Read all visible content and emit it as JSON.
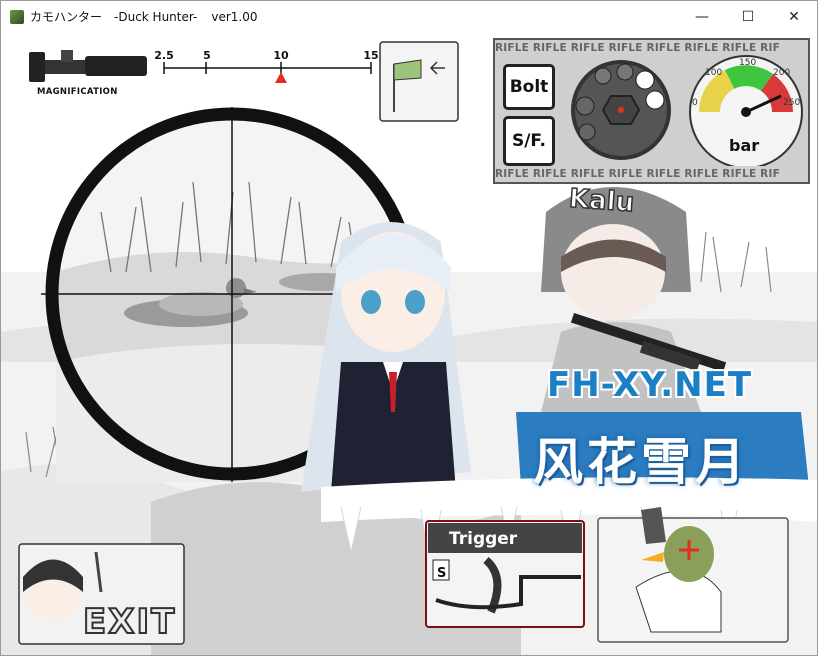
{
  "window": {
    "title_parts": [
      "カモハンター",
      "-Duck Hunter-",
      "ver1.00"
    ],
    "controls": {
      "minimize": "—",
      "maximize": "☐",
      "close": "✕"
    }
  },
  "scope": {
    "magnification_label": "MAGNIFICATION",
    "ticks": [
      "2.5",
      "5",
      "10",
      "15"
    ],
    "current": 10
  },
  "panel": {
    "rifle_text": "RIFLE RIFLE RIFLE RIFLE RIFLE RIFLE RIFLE RIF",
    "bolt_label": "Bolt",
    "sf_label": "S/F.",
    "gauge_unit": "bar",
    "gauge_marks": [
      "0",
      "100",
      "150",
      "200",
      "250"
    ]
  },
  "watermark": {
    "site": "FH-XY.NET",
    "name": "风花雪月"
  },
  "helmet_text": "Kalu",
  "buttons": {
    "exit": "EXIT",
    "trigger": "Trigger",
    "safety": "S"
  },
  "colors": {
    "gauge_yellow": "#e8d24a",
    "gauge_green": "#3ec43e",
    "gauge_red": "#d83a3a",
    "marker_red": "#e03020",
    "watermark_blue": "#1a7fc4"
  }
}
